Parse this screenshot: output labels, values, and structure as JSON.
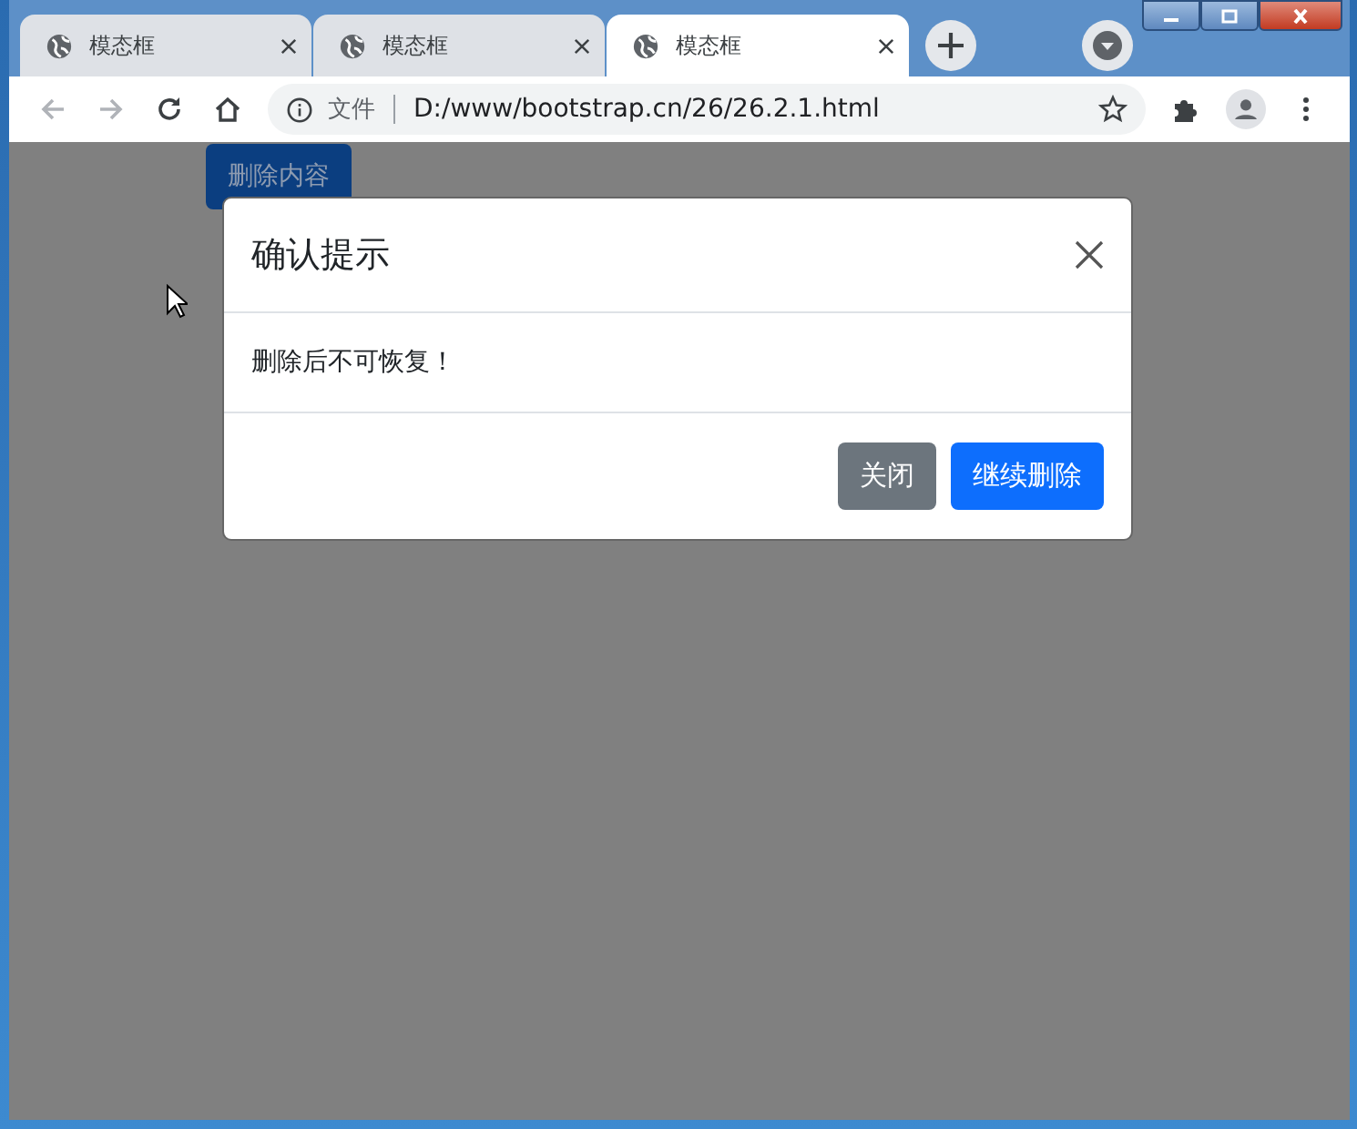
{
  "tabs": [
    {
      "label": "模态框",
      "selected": false
    },
    {
      "label": "模态框",
      "selected": false
    },
    {
      "label": "模态框",
      "selected": true
    }
  ],
  "address_bar": {
    "scheme_label": "文件",
    "url": "D:/www/bootstrap.cn/26/26.2.1.html"
  },
  "page": {
    "button": "删除内容"
  },
  "modal": {
    "title": "确认提示",
    "body": "删除后不可恢复！",
    "buttons": [
      {
        "label": "关闭",
        "kind": "secondary"
      },
      {
        "label": "继续删除",
        "kind": "primary"
      }
    ]
  }
}
